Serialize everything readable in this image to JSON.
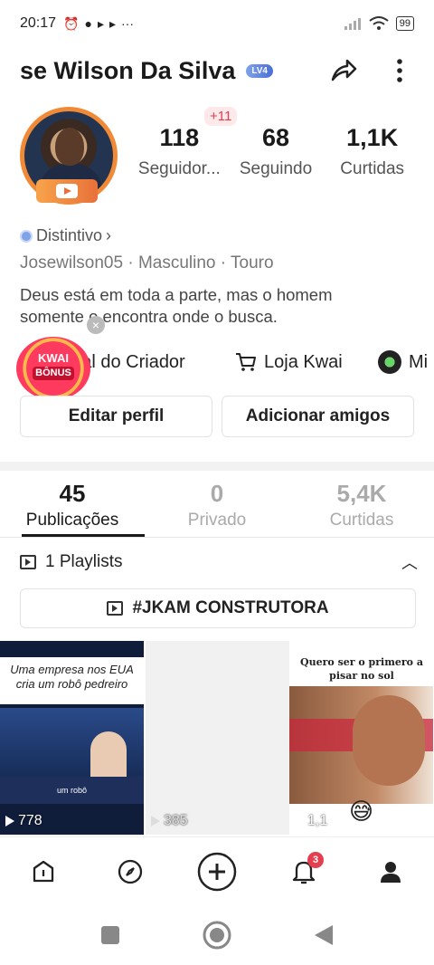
{
  "status_bar": {
    "time": "20:17",
    "battery": "99"
  },
  "header": {
    "name": "se Wilson Da Silva",
    "level_badge": "LV4"
  },
  "profile": {
    "stats": [
      {
        "value": "118",
        "label": "Seguidor..."
      },
      {
        "value": "68",
        "label": "Seguindo"
      },
      {
        "value": "1,1K",
        "label": "Curtidas"
      }
    ],
    "new_followers": "+11",
    "badge_label": "Distintivo",
    "meta": "Josewilson05 · Masculino · Touro",
    "bio": "Deus está em toda a parte, mas o homem somente o encontra onde o busca."
  },
  "shortcuts": {
    "creator_center": "tral do Criador",
    "kwai_shop": "Loja Kwai",
    "mini": "Mi",
    "kwai_bonus_line1": "KWAI",
    "kwai_bonus_line2": "BÔNUS"
  },
  "actions": {
    "edit_profile": "Editar perfil",
    "add_friends": "Adicionar amigos"
  },
  "tabs": [
    {
      "count": "45",
      "label": "Publicações"
    },
    {
      "count": "0",
      "label": "Privado"
    },
    {
      "count": "5,4K",
      "label": "Curtidas"
    }
  ],
  "playlists": {
    "title": "1 Playlists",
    "item": "#JKAM CONSTRUTORA"
  },
  "videos": [
    {
      "caption": "Uma empresa nos EUA cria um robô pedreiro",
      "ticker": "um robô",
      "views": "778"
    },
    {
      "caption": "",
      "views": "385"
    },
    {
      "caption": "Quero ser o primero a pisar no sol",
      "views": "1,1"
    }
  ],
  "bottom_nav": {
    "notifications_count": "3"
  },
  "colors": {
    "accent_red": "#e43f4f",
    "avatar_ring": "#f08a36",
    "level_badge": "#4b6fd6"
  }
}
